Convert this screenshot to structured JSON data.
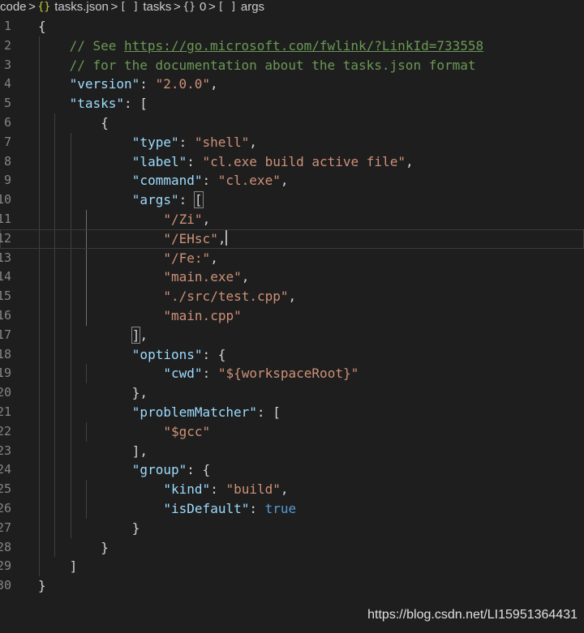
{
  "breadcrumb": {
    "items": [
      {
        "label": "code",
        "icon": "",
        "icon_name": ""
      },
      {
        "label": "tasks.json",
        "icon": "{}",
        "icon_name": "json-file-icon"
      },
      {
        "label": "tasks",
        "icon": "[ ]",
        "icon_name": "array-icon"
      },
      {
        "label": "0",
        "icon": "{}",
        "icon_name": "object-icon"
      },
      {
        "label": "args",
        "icon": "[ ]",
        "icon_name": "array-icon"
      }
    ],
    "separator": ">"
  },
  "editor": {
    "current_line": 12,
    "lines": [
      {
        "n": "1",
        "indent": 0,
        "tokens": [
          [
            "p",
            "{"
          ]
        ]
      },
      {
        "n": "2",
        "indent": 2,
        "tokens": [
          [
            "c",
            "// See "
          ],
          [
            "l",
            "https://go.microsoft.com/fwlink/?LinkId=733558"
          ]
        ]
      },
      {
        "n": "3",
        "indent": 2,
        "tokens": [
          [
            "c",
            "// for the documentation about the tasks.json format"
          ]
        ]
      },
      {
        "n": "4",
        "indent": 2,
        "tokens": [
          [
            "k",
            "\"version\""
          ],
          [
            "p",
            ": "
          ],
          [
            "s",
            "\"2.0.0\""
          ],
          [
            "p",
            ","
          ]
        ]
      },
      {
        "n": "5",
        "indent": 2,
        "tokens": [
          [
            "k",
            "\"tasks\""
          ],
          [
            "p",
            ": ["
          ]
        ]
      },
      {
        "n": "6",
        "indent": 4,
        "tokens": [
          [
            "p",
            "{"
          ]
        ]
      },
      {
        "n": "7",
        "indent": 6,
        "tokens": [
          [
            "k",
            "\"type\""
          ],
          [
            "p",
            ": "
          ],
          [
            "s",
            "\"shell\""
          ],
          [
            "p",
            ","
          ]
        ]
      },
      {
        "n": "8",
        "indent": 6,
        "tokens": [
          [
            "k",
            "\"label\""
          ],
          [
            "p",
            ": "
          ],
          [
            "s",
            "\"cl.exe build active file\""
          ],
          [
            "p",
            ","
          ]
        ]
      },
      {
        "n": "9",
        "indent": 6,
        "tokens": [
          [
            "k",
            "\"command\""
          ],
          [
            "p",
            ": "
          ],
          [
            "s",
            "\"cl.exe\""
          ],
          [
            "p",
            ","
          ]
        ]
      },
      {
        "n": "10",
        "indent": 6,
        "tokens": [
          [
            "k",
            "\"args\""
          ],
          [
            "p",
            ": "
          ],
          [
            "m",
            "["
          ]
        ]
      },
      {
        "n": "11",
        "indent": 8,
        "tokens": [
          [
            "s",
            "\"/Zi\""
          ],
          [
            "p",
            ","
          ]
        ]
      },
      {
        "n": "12",
        "indent": 8,
        "tokens": [
          [
            "s",
            "\"/EHsc\""
          ],
          [
            "p",
            ","
          ],
          [
            "cursor",
            ""
          ]
        ]
      },
      {
        "n": "13",
        "indent": 8,
        "tokens": [
          [
            "s",
            "\"/Fe:\""
          ],
          [
            "p",
            ","
          ]
        ]
      },
      {
        "n": "14",
        "indent": 8,
        "tokens": [
          [
            "s",
            "\"main.exe\""
          ],
          [
            "p",
            ","
          ]
        ]
      },
      {
        "n": "15",
        "indent": 8,
        "tokens": [
          [
            "s",
            "\"./src/test.cpp\""
          ],
          [
            "p",
            ","
          ]
        ]
      },
      {
        "n": "16",
        "indent": 8,
        "tokens": [
          [
            "s",
            "\"main.cpp\""
          ]
        ]
      },
      {
        "n": "17",
        "indent": 6,
        "tokens": [
          [
            "m",
            "]"
          ],
          [
            "p",
            ","
          ]
        ]
      },
      {
        "n": "18",
        "indent": 6,
        "tokens": [
          [
            "k",
            "\"options\""
          ],
          [
            "p",
            ": {"
          ]
        ]
      },
      {
        "n": "19",
        "indent": 8,
        "tokens": [
          [
            "k",
            "\"cwd\""
          ],
          [
            "p",
            ": "
          ],
          [
            "s",
            "\"${workspaceRoot}\""
          ]
        ]
      },
      {
        "n": "20",
        "indent": 6,
        "tokens": [
          [
            "p",
            "},"
          ]
        ]
      },
      {
        "n": "21",
        "indent": 6,
        "tokens": [
          [
            "k",
            "\"problemMatcher\""
          ],
          [
            "p",
            ": ["
          ]
        ]
      },
      {
        "n": "22",
        "indent": 8,
        "tokens": [
          [
            "s",
            "\"$gcc\""
          ]
        ]
      },
      {
        "n": "23",
        "indent": 6,
        "tokens": [
          [
            "p",
            "],"
          ]
        ]
      },
      {
        "n": "24",
        "indent": 6,
        "tokens": [
          [
            "k",
            "\"group\""
          ],
          [
            "p",
            ": {"
          ]
        ]
      },
      {
        "n": "25",
        "indent": 8,
        "tokens": [
          [
            "k",
            "\"kind\""
          ],
          [
            "p",
            ": "
          ],
          [
            "s",
            "\"build\""
          ],
          [
            "p",
            ","
          ]
        ]
      },
      {
        "n": "26",
        "indent": 8,
        "tokens": [
          [
            "k",
            "\"isDefault\""
          ],
          [
            "p",
            ": "
          ],
          [
            "b",
            "true"
          ]
        ]
      },
      {
        "n": "27",
        "indent": 6,
        "tokens": [
          [
            "p",
            "}"
          ]
        ]
      },
      {
        "n": "28",
        "indent": 4,
        "tokens": [
          [
            "p",
            "}"
          ]
        ]
      },
      {
        "n": "29",
        "indent": 2,
        "tokens": [
          [
            "p",
            "]"
          ]
        ]
      },
      {
        "n": "30",
        "indent": 0,
        "tokens": [
          [
            "p",
            "}"
          ]
        ]
      }
    ]
  },
  "watermark": {
    "text": "https://blog.csdn.net/LI15951364431"
  },
  "colors": {
    "background": "#1e1e1e",
    "key": "#9cdcfe",
    "string": "#ce9178",
    "comment": "#6a9955",
    "boolean": "#569cd6",
    "line_number": "#858585"
  }
}
